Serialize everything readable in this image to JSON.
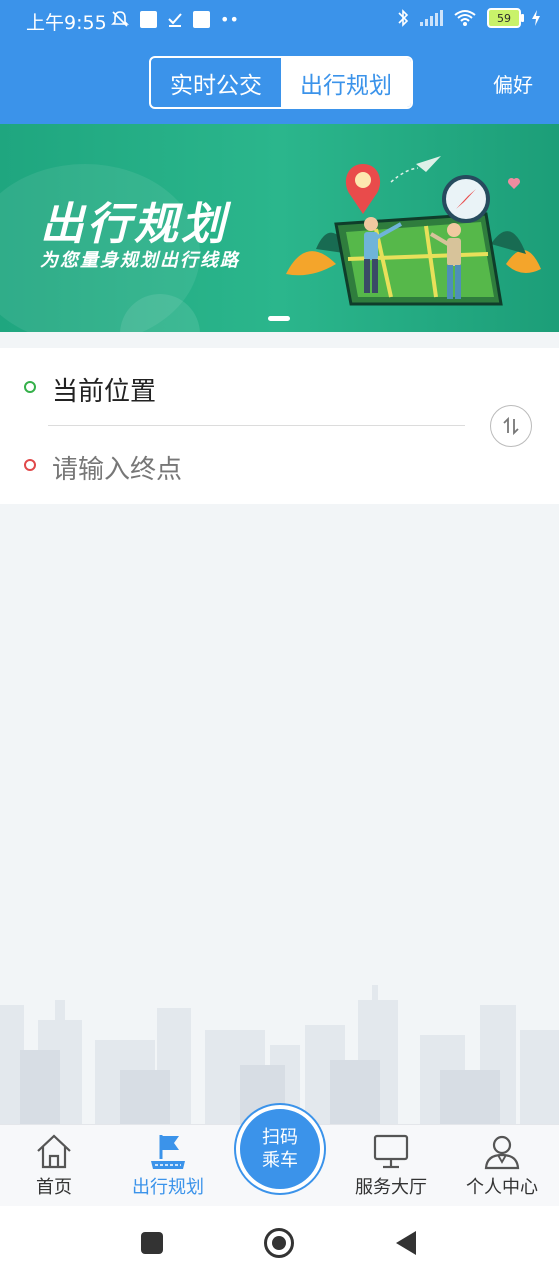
{
  "status_bar": {
    "time": "上午9:55",
    "battery": "59"
  },
  "nav": {
    "tabs": [
      {
        "label": "实时公交",
        "active": false
      },
      {
        "label": "出行规划",
        "active": true
      }
    ],
    "preference_label": "偏好"
  },
  "banner": {
    "title": "出行规划",
    "subtitle": "为您量身规划出行线路"
  },
  "route": {
    "start_text": "当前位置",
    "end_placeholder": "请输入终点"
  },
  "bottom_nav": {
    "items": [
      {
        "label": "首页",
        "icon": "home-icon",
        "active": false
      },
      {
        "label": "出行规划",
        "icon": "flag-route-icon",
        "active": true
      },
      {
        "label": "服务大厅",
        "icon": "monitor-icon",
        "active": false
      },
      {
        "label": "个人中心",
        "icon": "user-icon",
        "active": false
      }
    ],
    "scan_line1": "扫码",
    "scan_line2": "乘车"
  },
  "colors": {
    "primary": "#3b93ea",
    "banner_green": "#1fa67f"
  }
}
